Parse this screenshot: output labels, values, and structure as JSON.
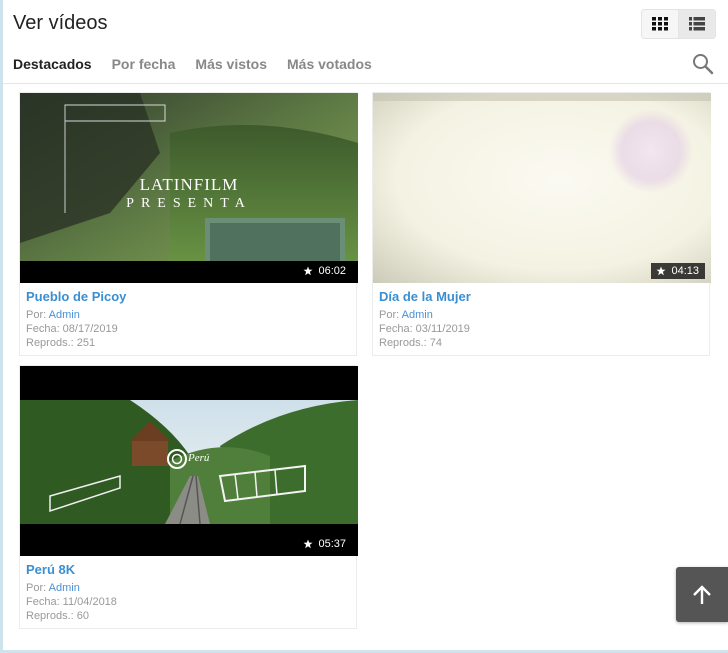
{
  "page": {
    "title": "Ver vídeos"
  },
  "view_toggle": {
    "grid_icon": "grid-icon",
    "list_icon": "list-icon"
  },
  "tabs": [
    {
      "label": "Destacados",
      "active": true
    },
    {
      "label": "Por fecha",
      "active": false
    },
    {
      "label": "Más vistos",
      "active": false
    },
    {
      "label": "Más votados",
      "active": false
    }
  ],
  "search": {
    "icon": "search-icon"
  },
  "videos": [
    {
      "title": "Pueblo de Picoy",
      "duration": "06:02",
      "by_label": "Por:",
      "author": "Admin",
      "date": "Fecha: 08/17/2019",
      "plays": "Reprods.: 251",
      "thumb_text_1": "LATINFILM",
      "thumb_text_2": "PRESENTA"
    },
    {
      "title": "Día de la Mujer",
      "duration": "04:13",
      "by_label": "Por:",
      "author": "Admin",
      "date": "Fecha: 03/11/2019",
      "plays": "Reprods.: 74"
    },
    {
      "title": "Perú 8K",
      "duration": "05:37",
      "by_label": "Por:",
      "author": "Admin",
      "date": "Fecha: 11/04/2018",
      "plays": "Reprods.: 60",
      "thumb_logo": "Perú"
    }
  ],
  "scroll_top": {
    "icon": "arrow-up-icon"
  },
  "colors": {
    "link": "#3b8fd1",
    "meta": "#999999",
    "scroll_button": "#555555"
  }
}
